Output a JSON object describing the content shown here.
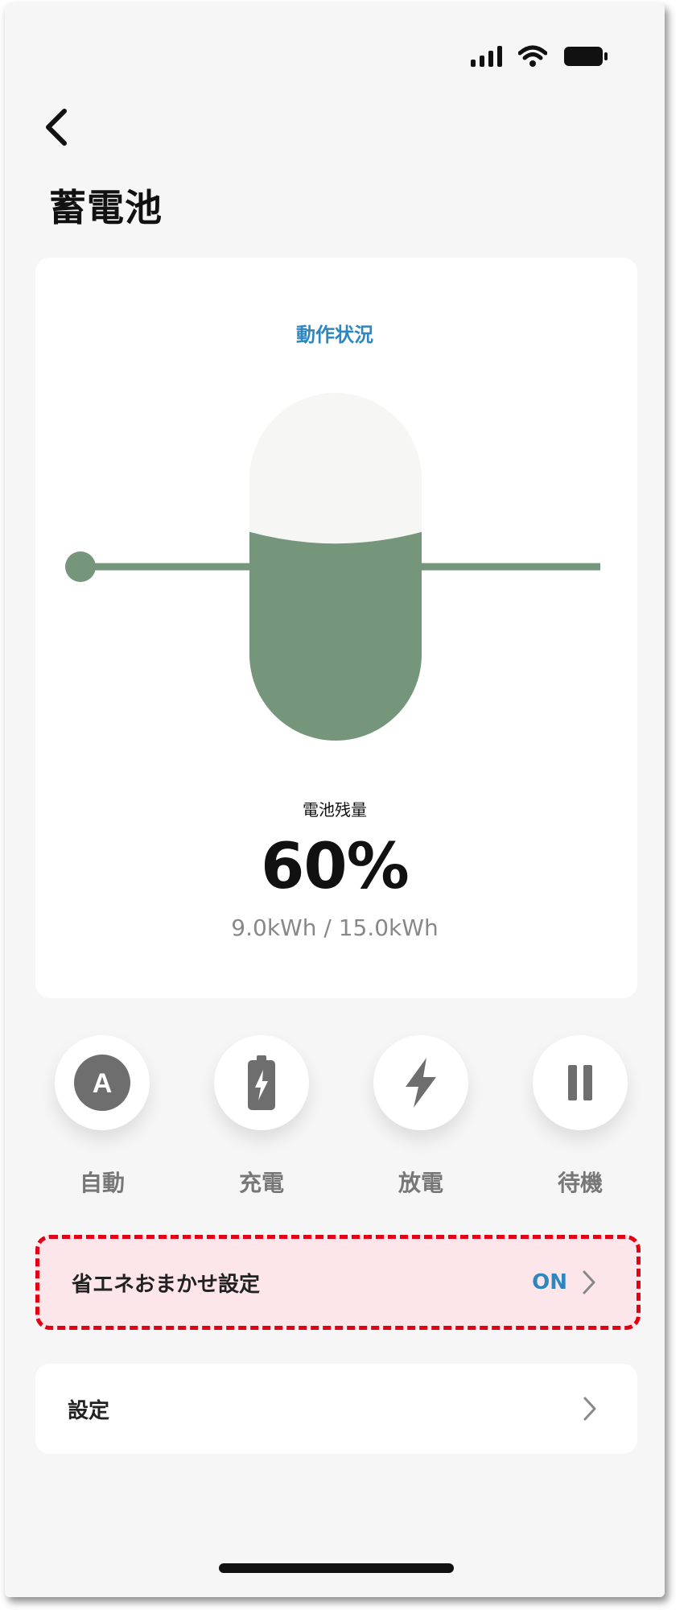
{
  "page": {
    "title": "蓄電池"
  },
  "status_card": {
    "label": "動作状況",
    "remaining_label": "電池残量",
    "percent": "60%",
    "capacity": "9.0kWh / 15.0kWh",
    "fill_fraction": 0.6,
    "colors": {
      "fill": "#76967b",
      "empty": "#f6f6f4",
      "accent": "#2e86c1"
    }
  },
  "modes": [
    {
      "label": "自動",
      "icon": "auto-a-icon"
    },
    {
      "label": "充電",
      "icon": "battery-charge-icon"
    },
    {
      "label": "放電",
      "icon": "lightning-icon"
    },
    {
      "label": "待機",
      "icon": "pause-icon"
    }
  ],
  "eco_setting": {
    "label": "省エネおまかせ設定",
    "value": "ON",
    "icon": "chevron-right-icon"
  },
  "settings": {
    "label": "設定",
    "icon": "chevron-right-icon"
  },
  "icons": {
    "back": "chevron-left-icon",
    "signal": "signal-icon",
    "wifi": "wifi-icon",
    "battery": "battery-status-icon"
  }
}
